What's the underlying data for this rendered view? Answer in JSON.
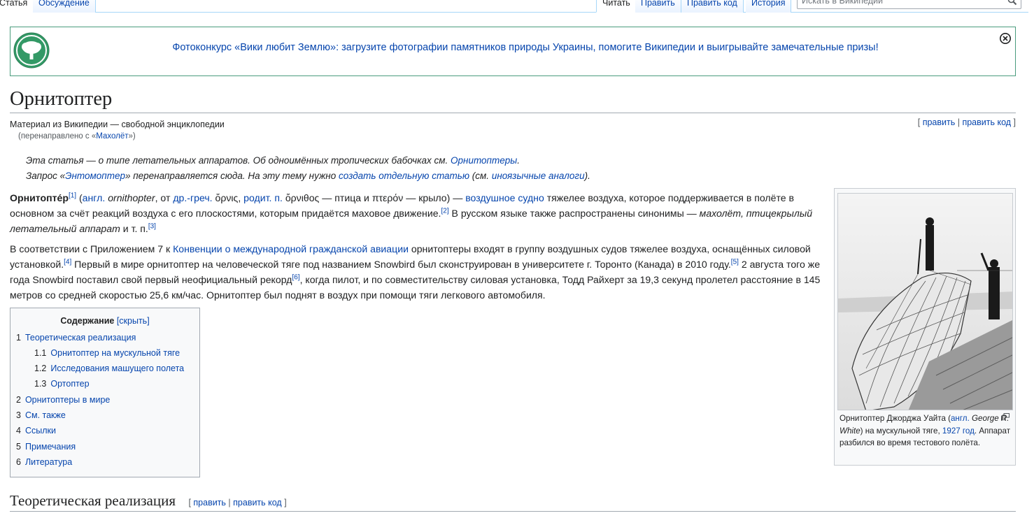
{
  "tabs": {
    "article": "Статья",
    "talk": "Обсуждение",
    "read": "Читать",
    "edit": "Править",
    "edit_source": "Править код",
    "history": "История"
  },
  "search": {
    "placeholder": "Искать в Википедии"
  },
  "banner": {
    "text": "Фотоконкурс «Вики любит Землю»: загрузите фотографии памятников природы Украины, помогите Википедии и выигрывайте замечательные призы!"
  },
  "title": "Орнитоптер",
  "tagline": "Материал из Википедии — свободной энциклопедии",
  "redirect": {
    "prefix": "(перенаправлено с «",
    "link": "Махолёт",
    "suffix": "»)"
  },
  "page_edit": {
    "open": "[ ",
    "edit": "править",
    "sep": " | ",
    "edit_source": "править код",
    "close": " ]"
  },
  "hatnote1": {
    "text": "Эта статья — о типе летательных аппаратов. Об одноимённых тропических бабочках см. ",
    "link": "Орнитоптеры",
    "end": "."
  },
  "hatnote2": {
    "t1": "Запрос «",
    "l1": "Энтомоптер",
    "t2": "» перенаправляется сюда. На эту тему нужно ",
    "l2": "создать отдельную статью",
    "t3": " (см. ",
    "l3": "иноязычные аналоги",
    "t4": ")."
  },
  "para1": {
    "term": "Орнитопте́р",
    "ref1": "[1]",
    "t1": " (",
    "l_eng": "англ.",
    "t2": " ",
    "eng_word": "ornithopter",
    "t3": ", от ",
    "l_greek": "др.-греч.",
    "t4": " ὄρνις, ",
    "l_gen": "родит. п.",
    "t5": " ὄρνιθος — птица и πτερόν — крыло) — ",
    "l_aircraft": "воздушное судно",
    "t6": " тяжелее воздуха, которое поддерживается в полёте в основном за счёт реакций воздуха с его плоскостями, которым придаётся маховое движение.",
    "ref2": "[2]",
    "t7": " В русском языке также распространены синонимы — ",
    "i1": "махолёт, птицекрылый летательный аппарат",
    "t8": " и т. п.",
    "ref3": "[3]"
  },
  "para2": {
    "t1": "В соответствии с Приложением 7 к ",
    "l1": "Конвенции о международной гражданской авиации",
    "t2": " орнитоптеры входят в группу воздушных судов тяжелее воздуха, оснащённых силовой установкой.",
    "ref4": "[4]",
    "t3": " Первый в мире орнитоптер на человеческой тяге под названием Snowbird был сконструирован в университете г. Торонто (Канада) в 2010 году.",
    "ref5": "[5]",
    "t4": " 2 августа того же года Snowbird поставил свой первый неофициальный рекорд",
    "ref6": "[6]",
    "t5": ", когда пилот, и по совместительству силовая установка, Тодд Райхерт за 19,3 секунд пролетел расстояние в 145 метров со средней скоростью 25,6 км/час. Орнитоптер был поднят в воздух при помощи тяги легкового автомобиля."
  },
  "toc": {
    "title": "Содержание",
    "toggle": "[скрыть]",
    "items": [
      {
        "num": "1",
        "label": "Теоретическая реализация"
      },
      {
        "num": "1.1",
        "label": "Орнитоптер на мускульной тяге"
      },
      {
        "num": "1.2",
        "label": "Исследования машущего полета"
      },
      {
        "num": "1.3",
        "label": "Ортоптер"
      },
      {
        "num": "2",
        "label": "Орнитоптеры в мире"
      },
      {
        "num": "3",
        "label": "См. также"
      },
      {
        "num": "4",
        "label": "Ссылки"
      },
      {
        "num": "5",
        "label": "Примечания"
      },
      {
        "num": "6",
        "label": "Литература"
      }
    ]
  },
  "thumb": {
    "c1": "Орнитоптер Джорджа Уайта (",
    "l_eng": "англ.",
    "c2": " ",
    "name": "George R. White",
    "c3": ") на мускульной тяге, ",
    "l_year": "1927 год",
    "c4": ". Аппарат разбился во время тестового полёта."
  },
  "section1": {
    "title": "Теоретическая реализация",
    "edit": "править",
    "edit_source": "править код"
  },
  "colors": {
    "link": "#0645ad",
    "banner_border": "#4a9c7d",
    "logo": "#339966"
  }
}
